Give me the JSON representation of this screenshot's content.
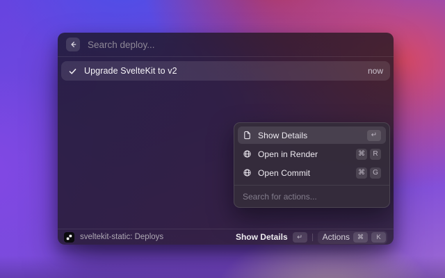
{
  "theme": {
    "wallpaper_blue": "#4a50e8",
    "wallpaper_purple": "#8850d8",
    "wallpaper_red": "#e04a60",
    "wallpaper_crimson": "#b83450",
    "wallpaper_cream": "#ecd6b0",
    "wallpaper_violet": "#a070d0",
    "selection_highlight": "rgba(255,255,255,0.10)",
    "window_tint": "#241a28"
  },
  "header": {
    "search_placeholder": "Search deploy..."
  },
  "results": [
    {
      "title": "Upgrade SvelteKit to v2",
      "meta": "now"
    }
  ],
  "actions_menu": {
    "items": [
      {
        "icon": "document-icon",
        "label": "Show Details",
        "shortcut": [
          "↵"
        ]
      },
      {
        "icon": "globe-icon",
        "label": "Open in Render",
        "shortcut": [
          "⌘",
          "R"
        ]
      },
      {
        "icon": "globe-icon",
        "label": "Open Commit",
        "shortcut": [
          "⌘",
          "G"
        ]
      }
    ],
    "search_placeholder": "Search for actions..."
  },
  "status_bar": {
    "source_label": "sveltekit-static: Deploys",
    "primary_action": "Show Details",
    "primary_key": "↵",
    "actions_label": "Actions",
    "actions_keys": [
      "⌘",
      "K"
    ]
  }
}
